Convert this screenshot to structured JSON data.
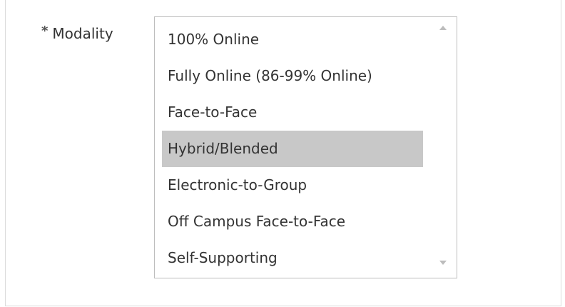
{
  "field": {
    "required_mark": "*",
    "label": "Modality"
  },
  "listbox": {
    "options": [
      "100% Online",
      "Fully Online (86-99% Online)",
      "Face-to-Face",
      "Hybrid/Blended",
      "Electronic-to-Group",
      "Off Campus Face-to-Face",
      "Self-Supporting"
    ],
    "selected_index": 3
  },
  "icons": {
    "required": "asterisk-icon",
    "scroll_up": "triangle-up-icon",
    "scroll_down": "triangle-down-icon"
  },
  "colors": {
    "selected_background": "#c8c8c8",
    "text": "#333333",
    "border": "#bdbdbd"
  }
}
